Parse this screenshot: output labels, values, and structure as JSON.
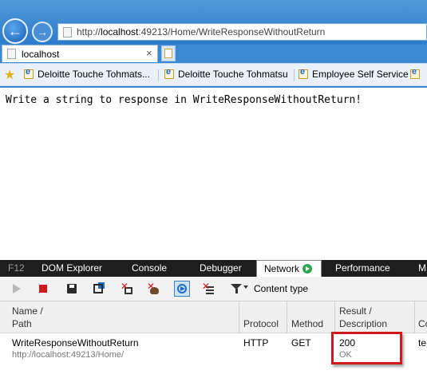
{
  "browser": {
    "address": {
      "prefix": "http://",
      "host": "localhost",
      "rest": ":49213/Home/WriteResponseWithoutReturn"
    },
    "tab": {
      "title": "localhost",
      "close": "×"
    },
    "favorites": [
      {
        "label": "Deloitte Touche Tohmats..."
      },
      {
        "label": "Deloitte Touche Tohmatsu"
      },
      {
        "label": "Employee Self Service"
      }
    ]
  },
  "page": {
    "text": "Write a string to response in WriteResponseWithoutReturn!"
  },
  "devtools": {
    "label": "F12",
    "tabs": [
      "DOM Explorer",
      "Console",
      "Debugger",
      "Network",
      "Performance",
      "M"
    ],
    "active_tab": "Network",
    "filter_label": "Content type",
    "columns": [
      {
        "line1": "Name /",
        "line2": "Path"
      },
      {
        "line1": "Protocol",
        "line2": ""
      },
      {
        "line1": "Method",
        "line2": ""
      },
      {
        "line1": "Result /",
        "line2": "Description"
      },
      {
        "line1": "Co",
        "line2": ""
      }
    ],
    "rows": [
      {
        "name": "WriteResponseWithoutReturn",
        "path": "http://localhost:49213/Home/",
        "protocol": "HTTP",
        "method": "GET",
        "result": "200",
        "description": "OK",
        "content": "te"
      }
    ]
  },
  "colors": {
    "highlight": "#d0191c",
    "chrome_blue": "#2d7bcb",
    "devtools_bar": "#1e1e1e"
  }
}
